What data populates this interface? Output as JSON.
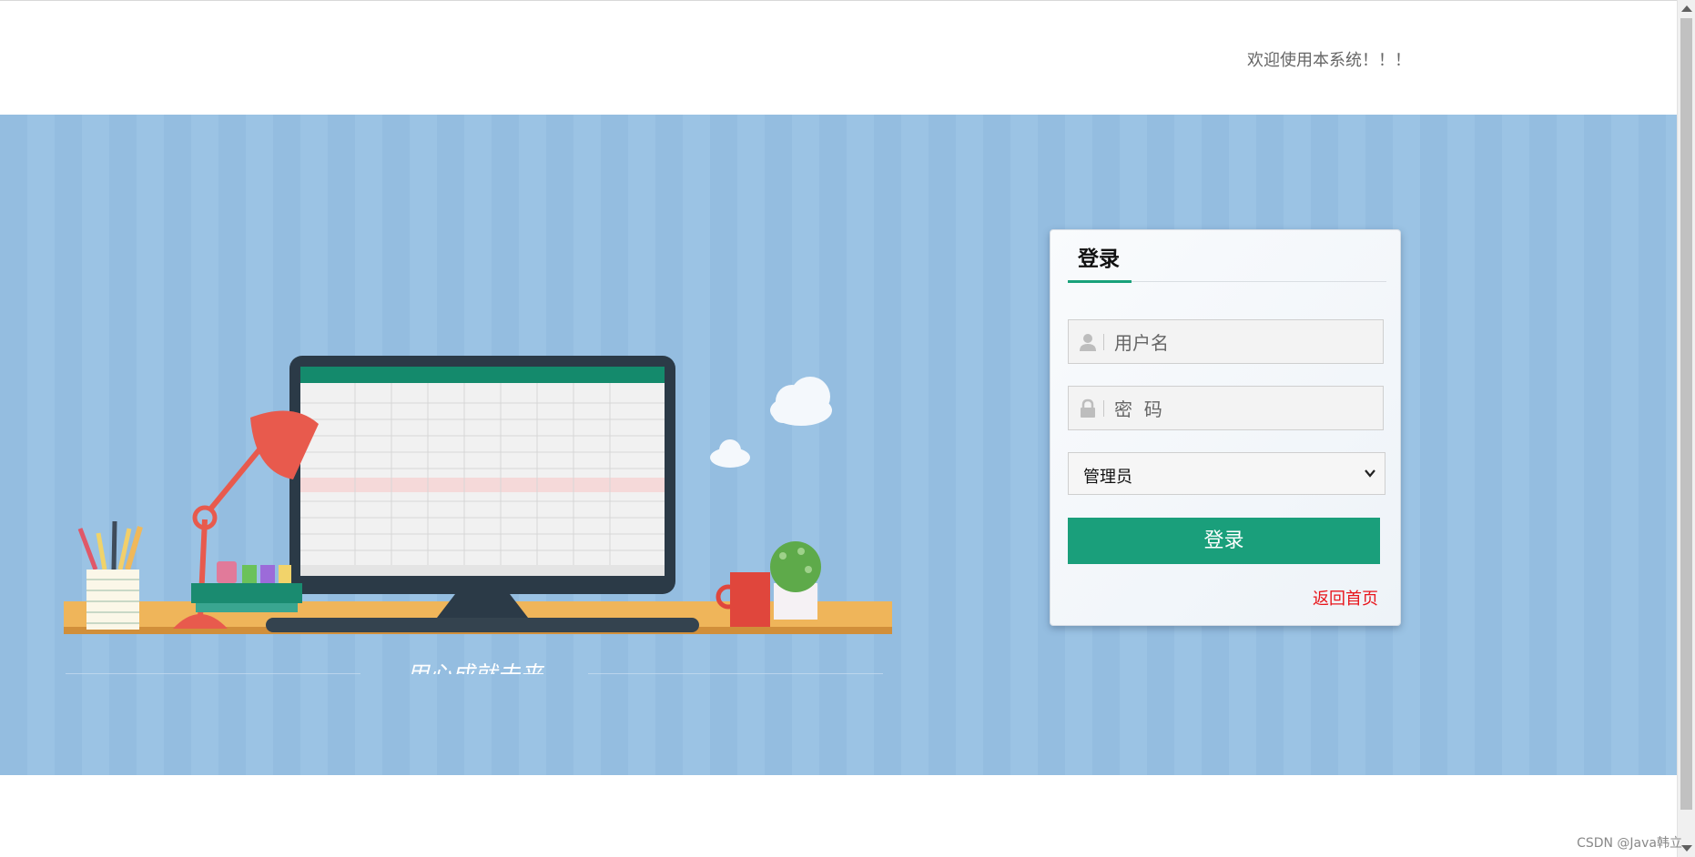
{
  "header": {
    "welcome_text": "欢迎使用本系统！！！"
  },
  "illustration": {
    "slogan": "用心成就未来"
  },
  "login": {
    "tab_label": "登录",
    "username_placeholder": "用户名",
    "password_placeholder": "密  码",
    "role_selected": "管理员",
    "submit_label": "登录",
    "back_link": "返回首页"
  },
  "footer": {
    "watermark": "CSDN @Java韩立"
  },
  "colors": {
    "banner": "#94bde0",
    "accent": "#1a9f7b",
    "link_red": "#e8151b"
  }
}
